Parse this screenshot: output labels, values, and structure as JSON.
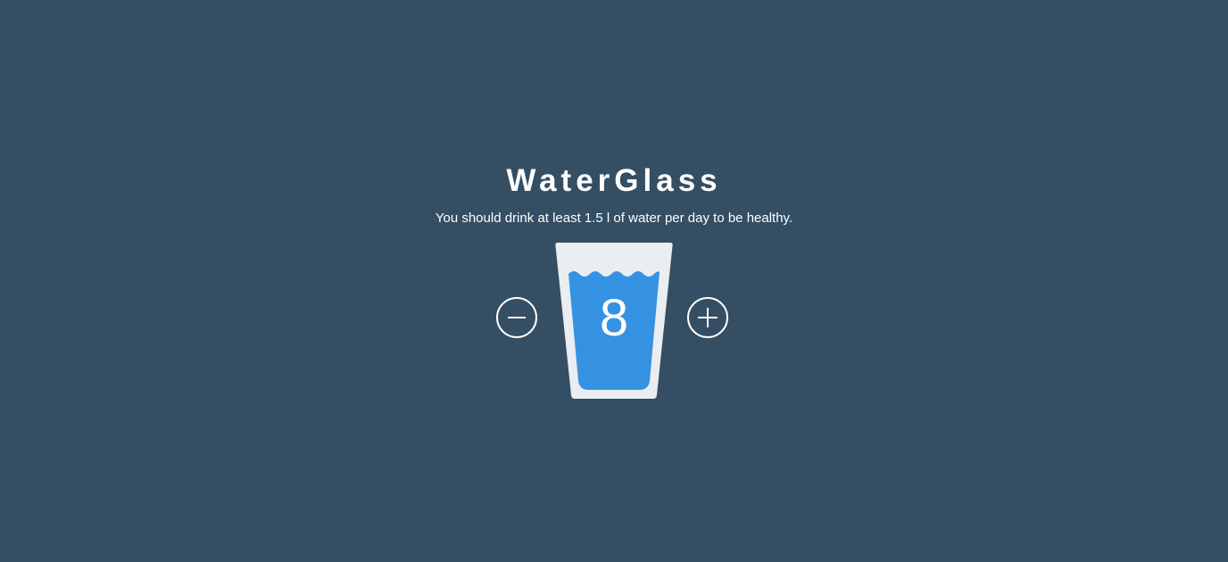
{
  "app": {
    "title": "WaterGlass",
    "subtitle": "You should drink at least 1.5 l of water per day to be healthy."
  },
  "counter": {
    "glasses": "8",
    "decrement_icon": "minus-icon",
    "increment_icon": "plus-icon"
  },
  "colors": {
    "background": "#344e63",
    "glass": "#eaedf1",
    "water": "#3592e3",
    "text": "#ffffff"
  }
}
